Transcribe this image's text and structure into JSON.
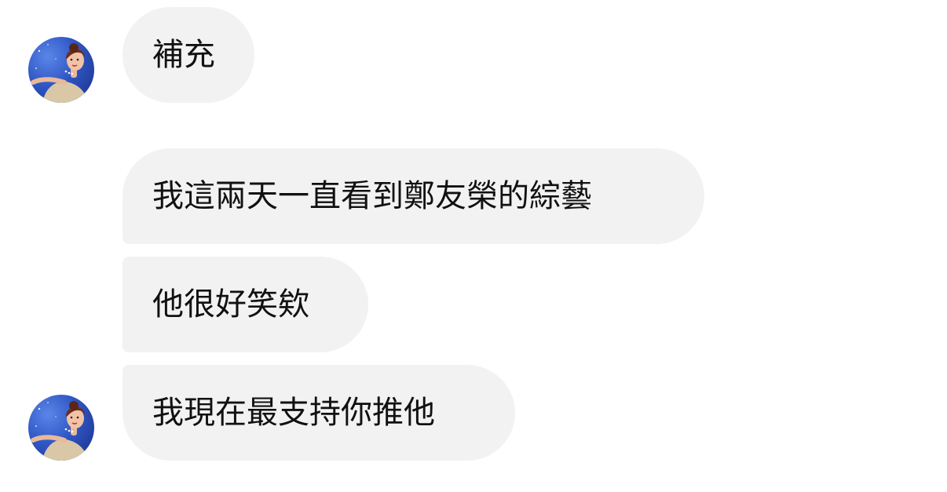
{
  "conversation": {
    "messages": [
      {
        "text": "補充"
      },
      {
        "text": "我這兩天一直看到鄭友榮的綜藝"
      },
      {
        "text": "他很好笑欸"
      },
      {
        "text": "我現在最支持你推他"
      }
    ]
  },
  "colors": {
    "bubble_background": "#f2f2f2",
    "text": "#111111",
    "page_background": "#ffffff",
    "avatar_background": "#2f56c4"
  },
  "icons": {
    "avatar": "profile-avatar"
  }
}
